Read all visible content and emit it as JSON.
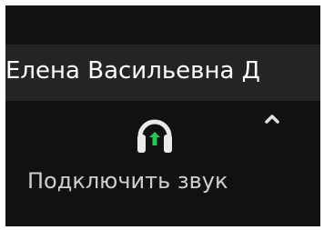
{
  "participant": {
    "name": "Елена Васильевна Д"
  },
  "toolbar": {
    "audio_label": "Подключить звук",
    "audio_icon": "headphone-with-up-arrow-icon",
    "caret_icon": "chevron-up-icon"
  },
  "colors": {
    "background": "#111111",
    "name_bar": "#242424",
    "text": "#ffffff",
    "muted_text": "#cfcfcf",
    "accent_green": "#26c45a"
  }
}
